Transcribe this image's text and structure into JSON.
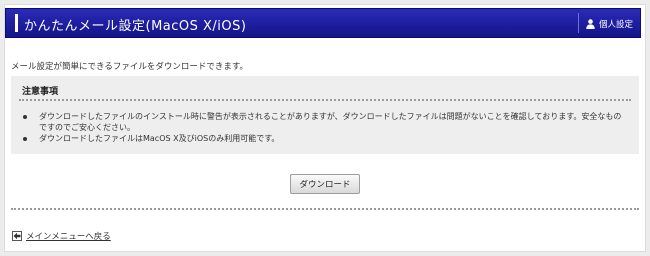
{
  "header": {
    "title": "かんたんメール設定(MacOS X/iOS)",
    "account_label": "個人設定",
    "account_icon": "user-icon",
    "colors": {
      "bar_top": "#2a2ab8",
      "bar_bottom": "#14148a"
    }
  },
  "intro": "メール設定が簡単にできるファイルをダウンロードできます。",
  "notice": {
    "heading": "注意事項",
    "items": [
      "ダウンロードしたファイルのインストール時に警告が表示されることがありますが、ダウンロードしたファイルは問題がないことを確認しております。安全なものですのでご安心ください。",
      "ダウンロードしたファイルはMacOS X及びiOSのみ利用可能です。"
    ]
  },
  "download_button": "ダウンロード",
  "back_link": {
    "label": "メインメニューへ戻る",
    "icon": "arrow-left-icon"
  }
}
